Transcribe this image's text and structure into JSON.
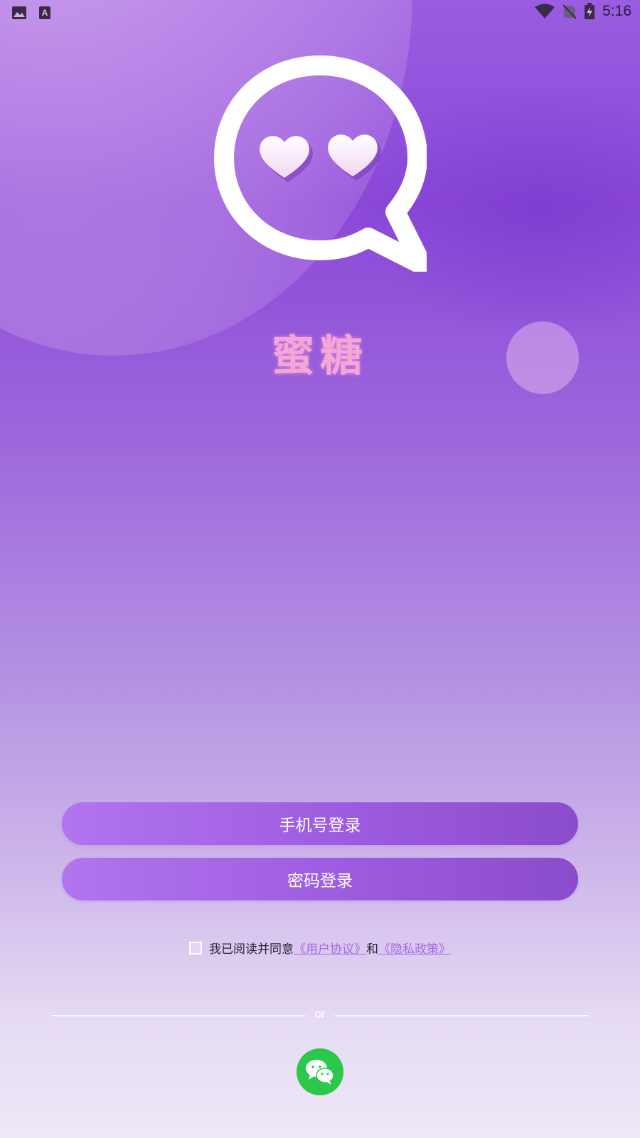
{
  "status_bar": {
    "time": "5:16",
    "left_icons": [
      "image-icon",
      "font-a-icon"
    ],
    "right_icons": [
      "wifi-icon",
      "no-sim-icon",
      "battery-charging-icon"
    ]
  },
  "app": {
    "name": "蜜糖",
    "logo_icon": "chat-bubble-hearts-icon"
  },
  "buttons": {
    "phone_login": "手机号登录",
    "password_login": "密码登录"
  },
  "agreement": {
    "prefix": "我已阅读并同意",
    "user_agreement": "《用户协议》",
    "conjunction": "和",
    "privacy_policy": "《隐私政策》",
    "checked": false
  },
  "divider": {
    "label": "or"
  },
  "social": {
    "wechat_icon": "wechat-icon"
  },
  "colors": {
    "app_name": "#f5a6d7",
    "button_start": "#b274ef",
    "button_end": "#8b4ccb",
    "link": "#a36be2",
    "wechat": "#2bc84b"
  }
}
